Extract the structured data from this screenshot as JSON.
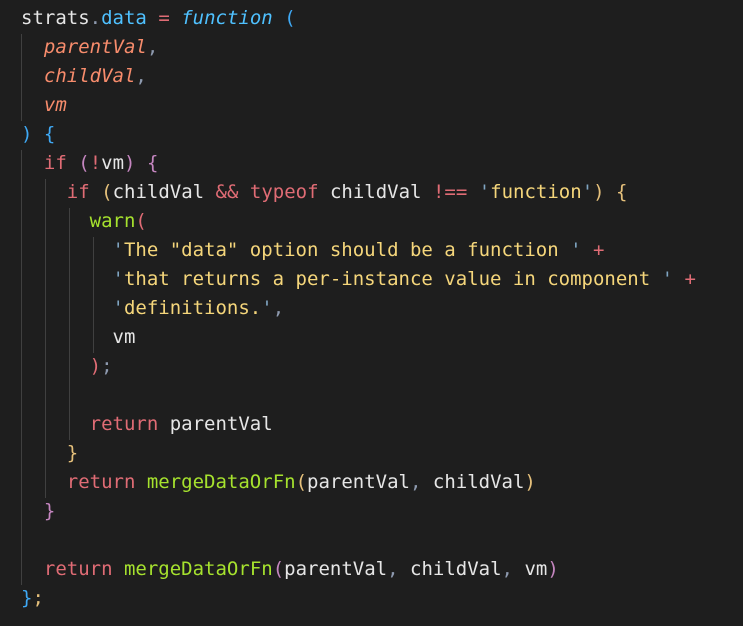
{
  "editor": {
    "colors": {
      "background": "#1e1e1e",
      "identifier": "#e6e6e6",
      "keyword": "#e06c75",
      "function_keyword": "#4fc1ff",
      "parameter": "#f78c6c",
      "string": "#f5d67b",
      "function_call": "#a6e22e"
    },
    "lines": [
      {
        "tokens": [
          {
            "t": "strats",
            "c": "id"
          },
          {
            "t": ".",
            "c": "punct"
          },
          {
            "t": "data",
            "c": "prop"
          },
          {
            "t": " ",
            "c": ""
          },
          {
            "t": "=",
            "c": "op"
          },
          {
            "t": " ",
            "c": ""
          },
          {
            "t": "function",
            "c": "fn-kw"
          },
          {
            "t": " ",
            "c": ""
          },
          {
            "t": "(",
            "c": "p1"
          }
        ]
      },
      {
        "tokens": [
          {
            "t": "  ",
            "c": ""
          },
          {
            "t": "parentVal",
            "c": "param"
          },
          {
            "t": ",",
            "c": "punct"
          }
        ]
      },
      {
        "tokens": [
          {
            "t": "  ",
            "c": ""
          },
          {
            "t": "childVal",
            "c": "param"
          },
          {
            "t": ",",
            "c": "punct"
          }
        ]
      },
      {
        "tokens": [
          {
            "t": "  ",
            "c": ""
          },
          {
            "t": "vm",
            "c": "param"
          }
        ]
      },
      {
        "tokens": [
          {
            "t": ")",
            "c": "p1"
          },
          {
            "t": " ",
            "c": ""
          },
          {
            "t": "{",
            "c": "p1"
          }
        ]
      },
      {
        "tokens": [
          {
            "t": "  ",
            "c": ""
          },
          {
            "t": "if",
            "c": "key"
          },
          {
            "t": " ",
            "c": ""
          },
          {
            "t": "(",
            "c": "p2"
          },
          {
            "t": "!",
            "c": "op"
          },
          {
            "t": "vm",
            "c": "id"
          },
          {
            "t": ")",
            "c": "p2"
          },
          {
            "t": " ",
            "c": ""
          },
          {
            "t": "{",
            "c": "p2"
          }
        ]
      },
      {
        "tokens": [
          {
            "t": "    ",
            "c": ""
          },
          {
            "t": "if",
            "c": "key"
          },
          {
            "t": " ",
            "c": ""
          },
          {
            "t": "(",
            "c": "p3"
          },
          {
            "t": "childVal",
            "c": "id"
          },
          {
            "t": " ",
            "c": ""
          },
          {
            "t": "&&",
            "c": "op"
          },
          {
            "t": " ",
            "c": ""
          },
          {
            "t": "typeof",
            "c": "key"
          },
          {
            "t": " ",
            "c": ""
          },
          {
            "t": "childVal",
            "c": "id"
          },
          {
            "t": " ",
            "c": ""
          },
          {
            "t": "!==",
            "c": "op"
          },
          {
            "t": " ",
            "c": ""
          },
          {
            "t": "'",
            "c": "quote"
          },
          {
            "t": "function",
            "c": "str"
          },
          {
            "t": "'",
            "c": "quote"
          },
          {
            "t": ")",
            "c": "p3"
          },
          {
            "t": " ",
            "c": ""
          },
          {
            "t": "{",
            "c": "p3"
          }
        ]
      },
      {
        "tokens": [
          {
            "t": "      ",
            "c": ""
          },
          {
            "t": "warn",
            "c": "fn"
          },
          {
            "t": "(",
            "c": "op"
          }
        ]
      },
      {
        "tokens": [
          {
            "t": "        ",
            "c": ""
          },
          {
            "t": "'",
            "c": "quote"
          },
          {
            "t": "The \"data\" option should be a function ",
            "c": "str"
          },
          {
            "t": "'",
            "c": "quote"
          },
          {
            "t": " ",
            "c": ""
          },
          {
            "t": "+",
            "c": "op"
          }
        ]
      },
      {
        "tokens": [
          {
            "t": "        ",
            "c": ""
          },
          {
            "t": "'",
            "c": "quote"
          },
          {
            "t": "that returns a per-instance value in component ",
            "c": "str"
          },
          {
            "t": "'",
            "c": "quote"
          },
          {
            "t": " ",
            "c": ""
          },
          {
            "t": "+",
            "c": "op"
          }
        ]
      },
      {
        "tokens": [
          {
            "t": "        ",
            "c": ""
          },
          {
            "t": "'",
            "c": "quote"
          },
          {
            "t": "definitions.",
            "c": "str"
          },
          {
            "t": "'",
            "c": "quote"
          },
          {
            "t": ",",
            "c": "punct"
          }
        ]
      },
      {
        "tokens": [
          {
            "t": "        ",
            "c": ""
          },
          {
            "t": "vm",
            "c": "id"
          }
        ]
      },
      {
        "tokens": [
          {
            "t": "      ",
            "c": ""
          },
          {
            "t": ")",
            "c": "op"
          },
          {
            "t": ";",
            "c": "punct"
          }
        ]
      },
      {
        "tokens": []
      },
      {
        "tokens": [
          {
            "t": "      ",
            "c": ""
          },
          {
            "t": "return",
            "c": "key"
          },
          {
            "t": " ",
            "c": ""
          },
          {
            "t": "parentVal",
            "c": "id"
          }
        ]
      },
      {
        "tokens": [
          {
            "t": "    ",
            "c": ""
          },
          {
            "t": "}",
            "c": "p3"
          }
        ]
      },
      {
        "tokens": [
          {
            "t": "    ",
            "c": ""
          },
          {
            "t": "return",
            "c": "key"
          },
          {
            "t": " ",
            "c": ""
          },
          {
            "t": "mergeDataOrFn",
            "c": "fn"
          },
          {
            "t": "(",
            "c": "p3"
          },
          {
            "t": "parentVal",
            "c": "id"
          },
          {
            "t": ",",
            "c": "punct"
          },
          {
            "t": " ",
            "c": ""
          },
          {
            "t": "childVal",
            "c": "id"
          },
          {
            "t": ")",
            "c": "p3"
          }
        ]
      },
      {
        "tokens": [
          {
            "t": "  ",
            "c": ""
          },
          {
            "t": "}",
            "c": "p2"
          }
        ]
      },
      {
        "tokens": []
      },
      {
        "tokens": [
          {
            "t": "  ",
            "c": ""
          },
          {
            "t": "return",
            "c": "key"
          },
          {
            "t": " ",
            "c": ""
          },
          {
            "t": "mergeDataOrFn",
            "c": "fn"
          },
          {
            "t": "(",
            "c": "p2"
          },
          {
            "t": "parentVal",
            "c": "id"
          },
          {
            "t": ",",
            "c": "punct"
          },
          {
            "t": " ",
            "c": ""
          },
          {
            "t": "childVal",
            "c": "id"
          },
          {
            "t": ",",
            "c": "punct"
          },
          {
            "t": " ",
            "c": ""
          },
          {
            "t": "vm",
            "c": "id"
          },
          {
            "t": ")",
            "c": "p2"
          }
        ]
      },
      {
        "tokens": [
          {
            "t": "}",
            "c": "p1"
          },
          {
            "t": ";",
            "c": "semi"
          }
        ]
      }
    ]
  }
}
